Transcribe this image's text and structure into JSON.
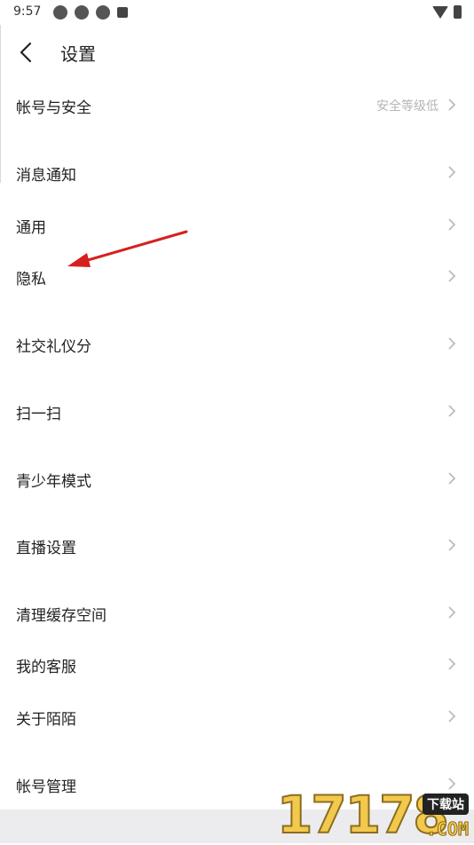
{
  "status_bar": {
    "time": "9:57"
  },
  "header": {
    "title": "设置"
  },
  "rows": [
    {
      "label": "帐号与安全",
      "sub": "安全等级低"
    },
    {
      "label": "消息通知"
    },
    {
      "label": "通用"
    },
    {
      "label": "隐私"
    },
    {
      "label": "社交礼仪分"
    },
    {
      "label": "扫一扫"
    },
    {
      "label": "青少年模式"
    },
    {
      "label": "直播设置"
    },
    {
      "label": "清理缓存空间"
    },
    {
      "label": "我的客服"
    },
    {
      "label": "关于陌陌"
    },
    {
      "label": "帐号管理"
    }
  ],
  "watermark": {
    "number": "17178",
    "badge": "下载站",
    "suffix": ".COM"
  },
  "colors": {
    "annotation_arrow": "#d62020",
    "watermark_gold": "#f2c94c"
  }
}
